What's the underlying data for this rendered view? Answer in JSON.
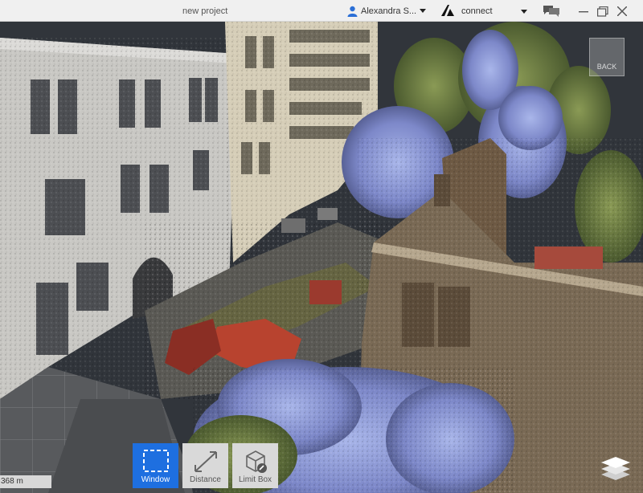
{
  "window": {
    "title": "new project"
  },
  "user": {
    "name": "Alexandra S..."
  },
  "connect": {
    "label": "connect"
  },
  "viewport": {
    "back_label": "BACK",
    "scale_readout": "368  m"
  },
  "toolbar": {
    "tools": [
      {
        "label": "Window",
        "active": true
      },
      {
        "label": "Distance",
        "active": false
      },
      {
        "label": "Limit Box",
        "active": false
      }
    ]
  },
  "colors": {
    "accent": "#1e6fe0",
    "titlebar_bg": "#f0f0f0",
    "viewport_bg": "#2e3136"
  }
}
